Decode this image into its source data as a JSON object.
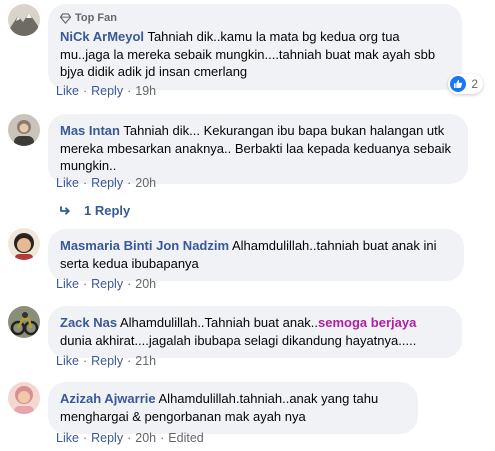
{
  "comments": [
    {
      "badge": "Top Fan",
      "author": "NiCk ArMeyol",
      "text": "Tahniah dik..kamu la mata bg kedua org tua mu..jaga la mereka sebaik mungkin....tahniah buat mak ayah sbb bjya didik adik jd insan cmerlang",
      "like": "Like",
      "reply": "Reply",
      "time": "19h",
      "reaction_count": "2"
    },
    {
      "author": "Mas Intan",
      "text": "Tahniah dik... Kekurangan ibu bapa bukan halangan utk mereka mbesarkan anaknya.. Berbakti laa kepada keduanya sebaik mungkin..",
      "like": "Like",
      "reply": "Reply",
      "time": "20h"
    },
    {
      "author": "Masmaria Binti Jon Nadzim",
      "text": "Alhamdulillah..tahniah buat anak ini serta kedua ibubapanya",
      "like": "Like",
      "reply": "Reply",
      "time": "20h"
    },
    {
      "author": "Zack Nas",
      "text_before": "Alhamdulillah..Tahniah buat anak..",
      "highlight": "semoga berjaya",
      "text_after": " dunia akhirat....jagalah ibubapa selagi dikandung hayatnya.....",
      "like": "Like",
      "reply": "Reply",
      "time": "21h"
    },
    {
      "author": "Azizah Ajwarrie",
      "text": "Alhamdulillah.tahniah..anak yang tahu menghargai & pengorbanan mak ayah nya",
      "like": "Like",
      "reply": "Reply",
      "time": "20h",
      "edited": "Edited"
    }
  ],
  "replies_link": "1 Reply",
  "colors": {
    "author": "#385898",
    "bubble": "#f0f2f5",
    "meta": "#65676b",
    "highlight": "#b01ea3",
    "like_blue": "#1877f2"
  },
  "icons": [
    "top-fan-diamond-icon",
    "like-thumb-icon",
    "reply-arrow-icon"
  ]
}
